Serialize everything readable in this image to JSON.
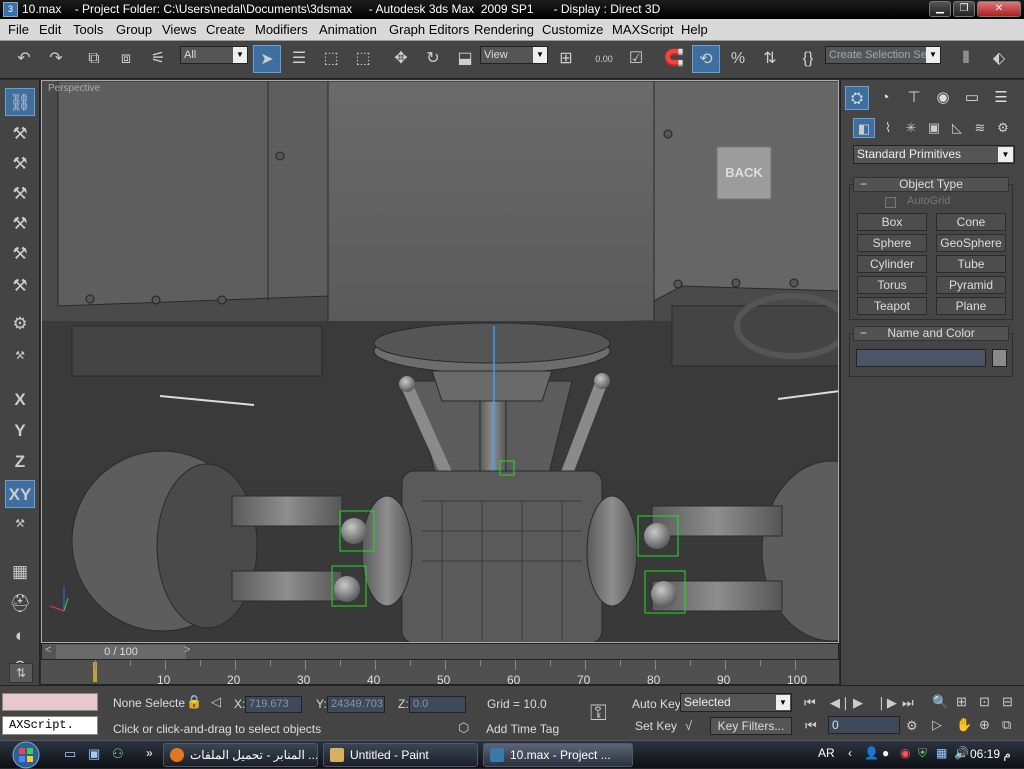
{
  "window": {
    "title": "10.max    - Project Folder: C:\\Users\\nedal\\Documents\\3dsmax     - Autodesk 3ds Max  2009 SP1      - Display : Direct 3D"
  },
  "menu": {
    "items": [
      "File",
      "Edit",
      "Tools",
      "Group",
      "Views",
      "Create",
      "Modifiers",
      "Animation",
      "Graph Editors",
      "Rendering",
      "Customize",
      "MAXScript",
      "Help"
    ]
  },
  "toolbar": {
    "selection_filter": "All",
    "ref_coord": "View",
    "named_selection": "Create Selection Se",
    "spinner_snap": "0.00"
  },
  "left_toolbar": {
    "axis_x": "X",
    "axis_y": "Y",
    "axis_z": "Z",
    "axis_xy": "XY"
  },
  "viewport": {
    "label": "Perspective",
    "back_sign": "BACK"
  },
  "command_panel": {
    "dropdown": "Standard Primitives",
    "object_type_title": "Object Type",
    "autogrid_label": "AutoGrid",
    "buttons": [
      "Box",
      "Cone",
      "Sphere",
      "GeoSphere",
      "Cylinder",
      "Tube",
      "Torus",
      "Pyramid",
      "Teapot",
      "Plane"
    ],
    "name_color_title": "Name and Color",
    "name_value": ""
  },
  "timeline": {
    "slider_text": "0 / 100",
    "current_frame": 0,
    "total_frames": 100,
    "tick_labels": [
      "10",
      "20",
      "30",
      "40",
      "50",
      "60",
      "70",
      "80",
      "90",
      "100"
    ]
  },
  "status": {
    "maxscript_label": "AXScript.",
    "selection": "None Selecte",
    "x_label": "X:",
    "x_value": "719.673",
    "y_label": "Y:",
    "y_value": "24349.703",
    "z_label": "Z:",
    "z_value": "0.0",
    "grid": "Grid = 10.0",
    "prompt": "Click or click-and-drag to select objects",
    "add_time_tag": "Add Time Tag",
    "auto_key": "Auto Key",
    "set_key": "Set Key",
    "selected_option": "Selected",
    "key_filters": "Key Filters...",
    "frame_value": "0"
  },
  "taskbar": {
    "tasks": [
      "المنابر - تحميل الملفات ...",
      "Untitled - Paint",
      "10.max     - Project ..."
    ],
    "lang": "AR",
    "time": "06:19 م"
  },
  "colors": {
    "accent": "#3f6f9f",
    "selection_box": "#22dd22",
    "viewport_bg": "#3b3b3b"
  }
}
